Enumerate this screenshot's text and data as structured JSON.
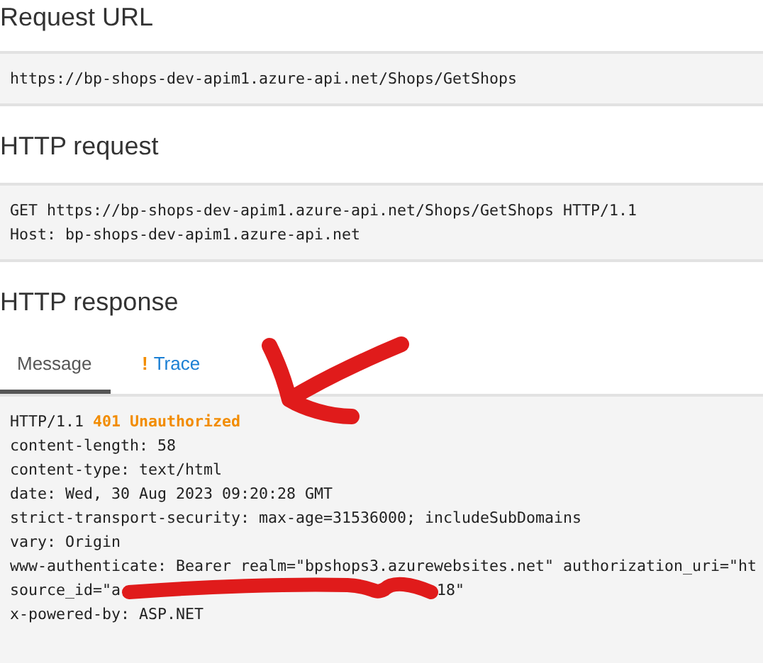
{
  "request_url": {
    "heading": "Request URL",
    "value": "https://bp-shops-dev-apim1.azure-api.net/Shops/GetShops"
  },
  "http_request": {
    "heading": "HTTP request",
    "lines": [
      "GET https://bp-shops-dev-apim1.azure-api.net/Shops/GetShops HTTP/1.1",
      "Host: bp-shops-dev-apim1.azure-api.net"
    ]
  },
  "http_response": {
    "heading": "HTTP response",
    "tabs": [
      {
        "label": "Message",
        "selected": true,
        "warning": false
      },
      {
        "label": "Trace",
        "selected": false,
        "warning": true,
        "warning_mark": "!"
      }
    ],
    "lines": [
      {
        "kind": "status",
        "text": "HTTP/1.1 **401 Unauthorized**"
      },
      {
        "kind": "plain",
        "text": "content-length: 58"
      },
      {
        "kind": "plain",
        "text": "content-type: text/html"
      },
      {
        "kind": "plain",
        "text": "date: Wed, 30 Aug 2023 09:20:28 GMT"
      },
      {
        "kind": "plain",
        "text": "strict-transport-security: max-age=31536000; includeSubDomains"
      },
      {
        "kind": "plain",
        "text": "vary: Origin"
      },
      {
        "kind": "plain",
        "text": "www-authenticate: Bearer realm=\"bpshops3.azurewebsites.net\" authorization_uri=\"ht"
      },
      {
        "kind": "redacted",
        "before": "source_id=\"a",
        "after": "18\""
      },
      {
        "kind": "plain",
        "text": "x-powered-by: ASP.NET"
      }
    ]
  }
}
